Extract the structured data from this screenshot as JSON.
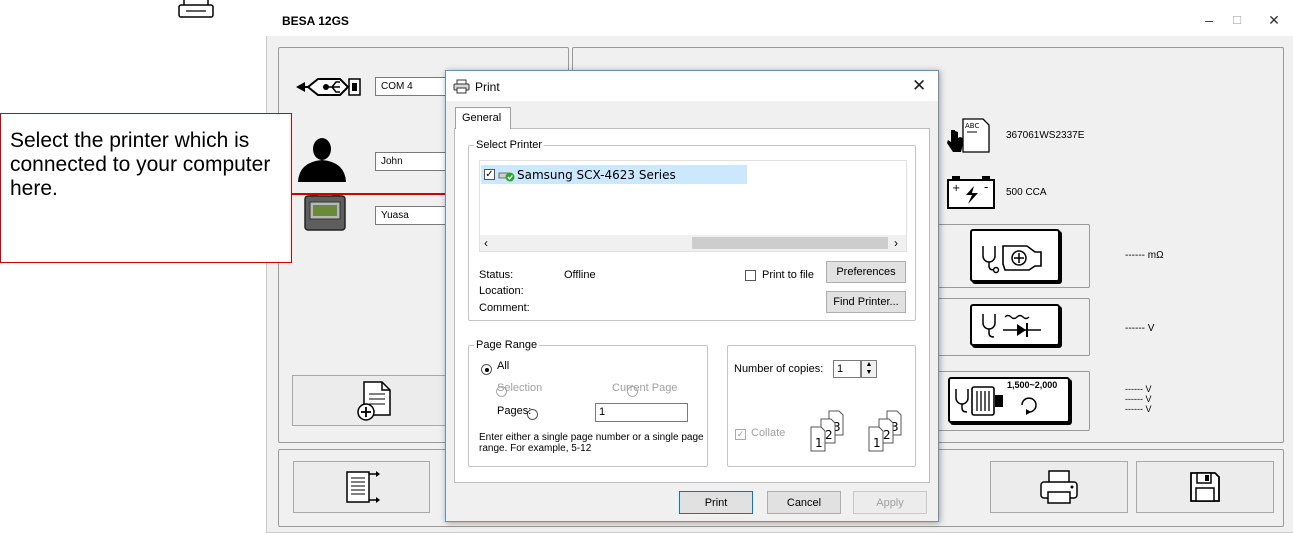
{
  "window": {
    "title": "BESA 12GS",
    "minimize": "–",
    "maximize": "☐",
    "close": "✕"
  },
  "left_panel": {
    "port_value": "COM 4",
    "user_value": "John",
    "battery_value": "Yuasa"
  },
  "right_panel": {
    "serial_value": "367061WS2337E",
    "cca_value": "500 CCA",
    "resistance_reading": "------ mΩ",
    "voltage_reading": "------ V",
    "starter_readings": [
      "------ V",
      "------ V",
      "------ V"
    ],
    "starter_rpm_label": "1,500~2,000"
  },
  "callout": {
    "text": "Select the printer which is connected to your computer here."
  },
  "print_dialog": {
    "title": "Print",
    "tab": "General",
    "select_printer": {
      "legend": "Select Printer",
      "printer_name": "Samsung SCX-4623 Series",
      "status_label": "Status:",
      "status_value": "Offline",
      "location_label": "Location:",
      "comment_label": "Comment:",
      "print_to_file": "Print to file",
      "preferences": "Preferences",
      "find_printer": "Find Printer..."
    },
    "page_range": {
      "legend": "Page Range",
      "all": "All",
      "selection": "Selection",
      "current_page": "Current Page",
      "pages": "Pages:",
      "pages_value": "1",
      "hint": "Enter either a single page number or a single page range.  For example, 5-12"
    },
    "copies": {
      "label": "Number of copies:",
      "value": "1",
      "collate": "Collate"
    },
    "buttons": {
      "print": "Print",
      "cancel": "Cancel",
      "apply": "Apply"
    }
  }
}
